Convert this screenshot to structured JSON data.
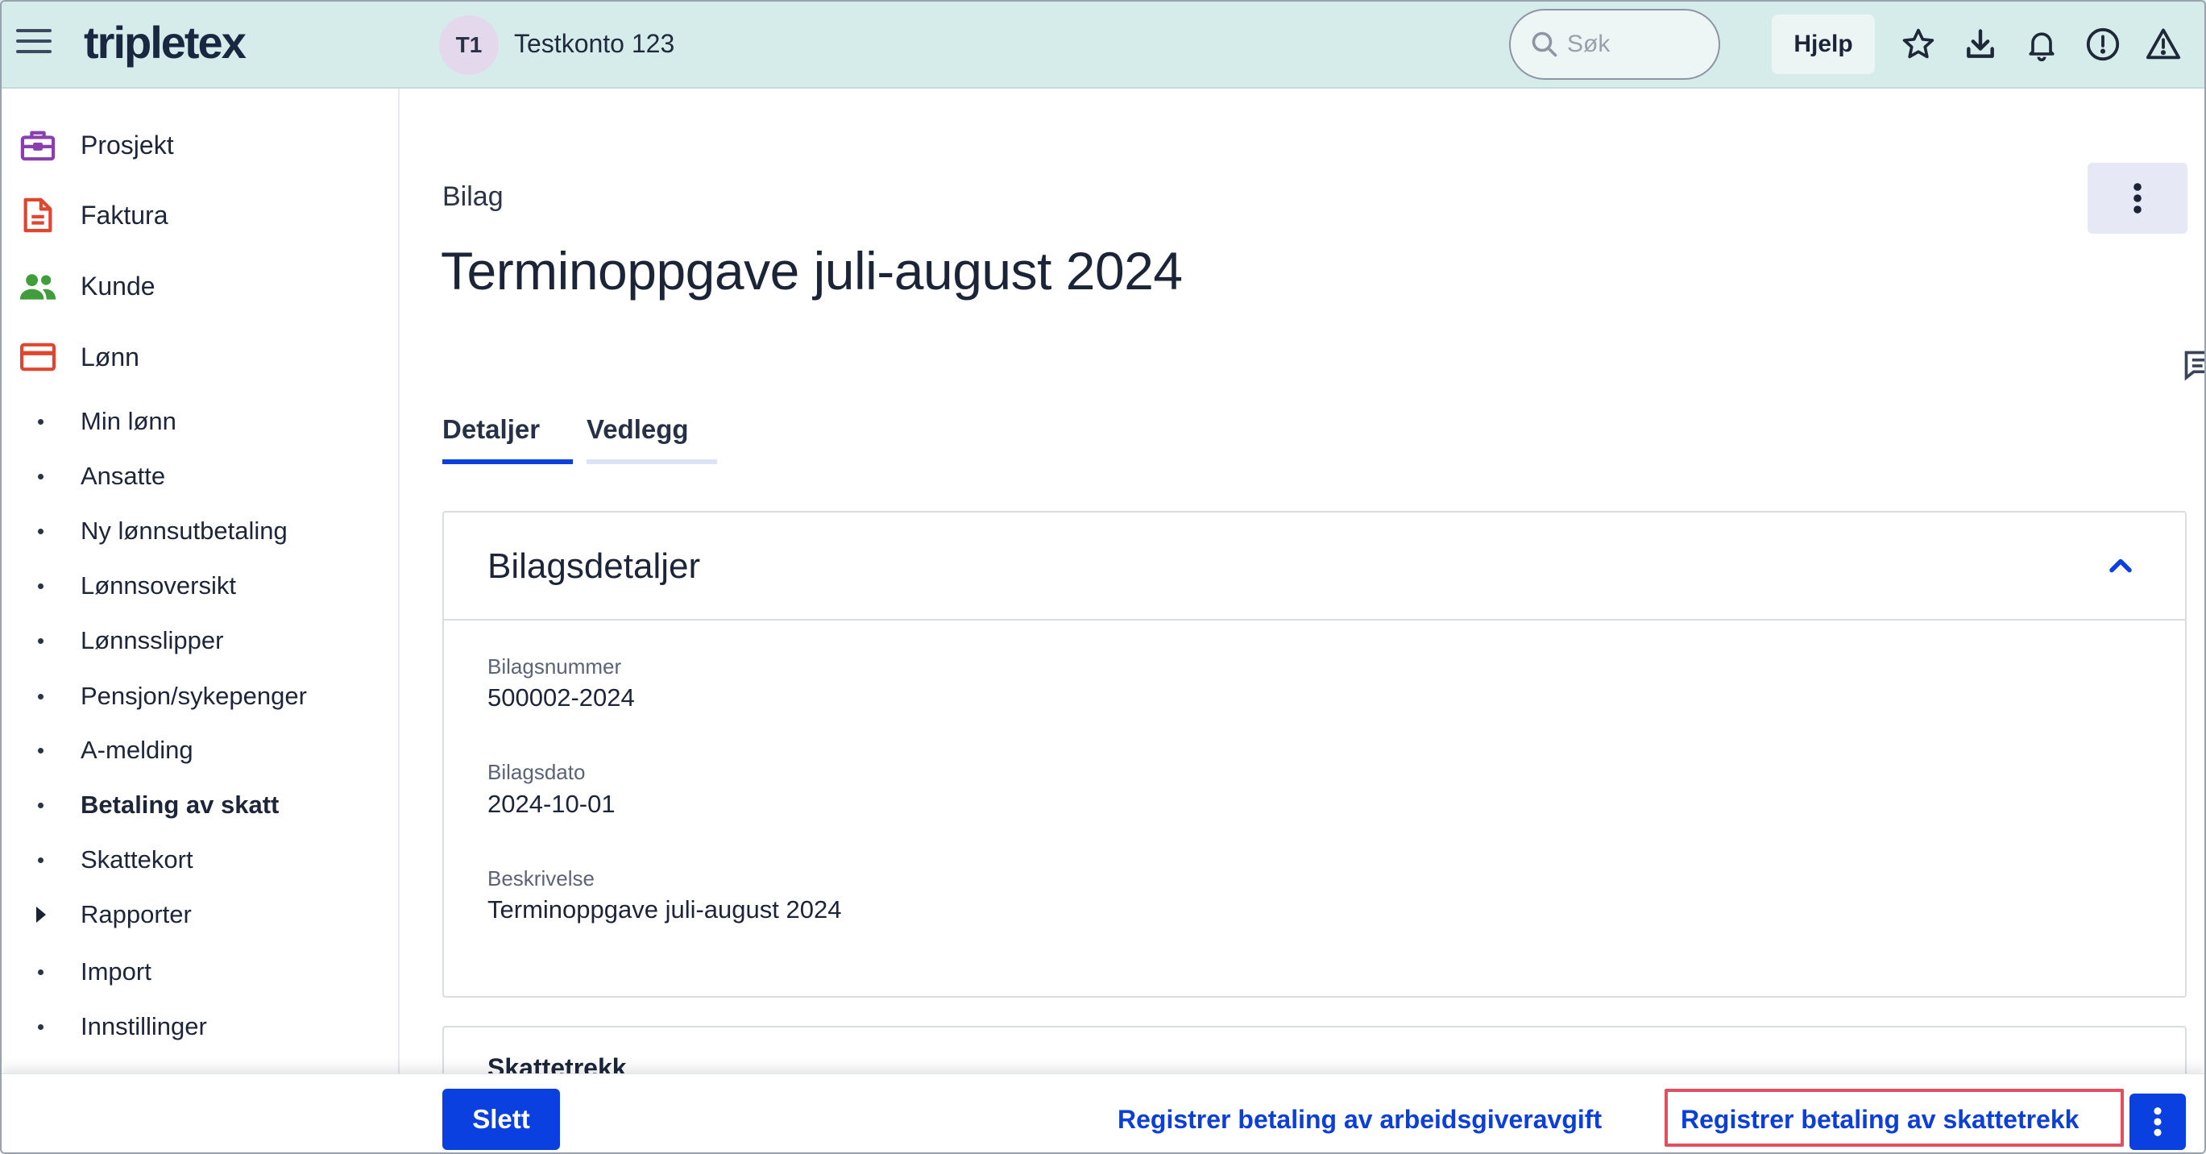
{
  "app": {
    "logo": "tripletex"
  },
  "header": {
    "avatar_initials": "T1",
    "company_name": "Testkonto 123",
    "search_placeholder": "Søk",
    "help_label": "Hjelp",
    "icons": [
      "star-icon",
      "download-icon",
      "bell-icon",
      "alert-circle-icon",
      "warning-icon"
    ]
  },
  "sidebar": {
    "main_items": [
      {
        "label": "Prosjekt",
        "icon": "briefcase-icon",
        "color": "#8a3fae"
      },
      {
        "label": "Faktura",
        "icon": "document-icon",
        "color": "#e0462f"
      },
      {
        "label": "Kunde",
        "icon": "users-icon",
        "color": "#3f9d3c"
      },
      {
        "label": "Lønn",
        "icon": "card-icon",
        "color": "#e0462f"
      }
    ],
    "sub_items": [
      {
        "label": "Min lønn"
      },
      {
        "label": "Ansatte"
      },
      {
        "label": "Ny lønnsutbetaling"
      },
      {
        "label": "Lønnsoversikt"
      },
      {
        "label": "Lønnsslipper"
      },
      {
        "label": "Pensjon/sykepenger"
      },
      {
        "label": "A-melding"
      },
      {
        "label": "Betaling av skatt",
        "active": true
      },
      {
        "label": "Skattekort"
      },
      {
        "label": "Rapporter",
        "expandable": true
      },
      {
        "label": "Import"
      },
      {
        "label": "Innstillinger"
      }
    ]
  },
  "main": {
    "breadcrumb": "Bilag",
    "title": "Terminoppgave juli-august 2024",
    "tabs": [
      {
        "label": "Detaljer",
        "active": true
      },
      {
        "label": "Vedlegg",
        "active": false
      }
    ],
    "details_card": {
      "title": "Bilagsdetaljer",
      "fields": [
        {
          "label": "Bilagsnummer",
          "value": "500002-2024"
        },
        {
          "label": "Bilagsdato",
          "value": "2024-10-01"
        },
        {
          "label": "Beskrivelse",
          "value": "Terminoppgave juli-august 2024"
        }
      ]
    },
    "tax_card": {
      "title": "Skattetrekk"
    }
  },
  "actions": {
    "delete_label": "Slett",
    "register_employer_tax_label": "Registrer betaling av arbeidsgiveravgift",
    "register_tax_deduction_label": "Registrer betaling av skattetrekk"
  },
  "colors": {
    "topbar": "#d6ecea",
    "primary": "#0a3fe0",
    "link": "#0c3ed8",
    "highlight": "#e0505e"
  }
}
